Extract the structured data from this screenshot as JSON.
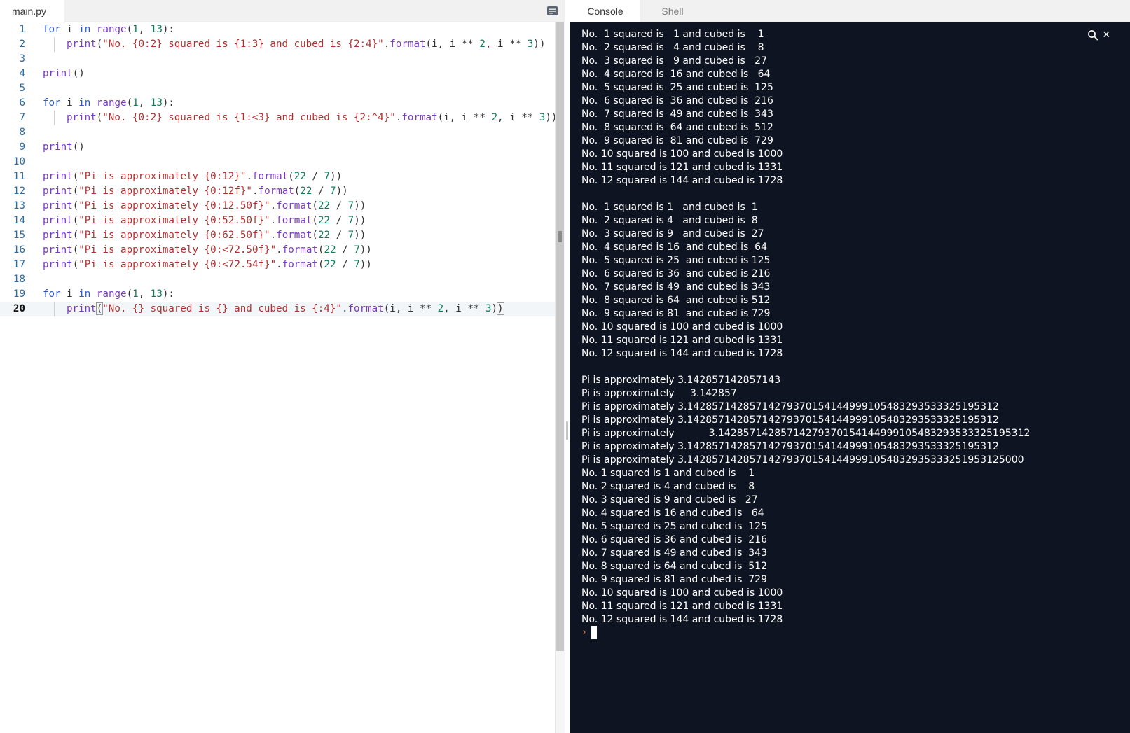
{
  "editor": {
    "tab_label": "main.py",
    "active_line": 20,
    "lines": [
      {
        "num": "1",
        "tokens": [
          [
            "k",
            "for"
          ],
          [
            "o",
            " i "
          ],
          [
            "k",
            "in"
          ],
          [
            "o",
            " "
          ],
          [
            "f",
            "range"
          ],
          [
            "o",
            "("
          ],
          [
            "n",
            "1"
          ],
          [
            "o",
            ", "
          ],
          [
            "n",
            "13"
          ],
          [
            "o",
            "):"
          ]
        ]
      },
      {
        "num": "2",
        "indent": true,
        "tokens": [
          [
            "f",
            "print"
          ],
          [
            "o",
            "("
          ],
          [
            "s",
            "\"No. {0:2} squared is {1:3} and cubed is {2:4}\""
          ],
          [
            "o",
            "."
          ],
          [
            "f",
            "format"
          ],
          [
            "o",
            "(i, i ** "
          ],
          [
            "n",
            "2"
          ],
          [
            "o",
            ", i ** "
          ],
          [
            "n",
            "3"
          ],
          [
            "o",
            "))"
          ]
        ]
      },
      {
        "num": "3",
        "tokens": []
      },
      {
        "num": "4",
        "tokens": [
          [
            "f",
            "print"
          ],
          [
            "o",
            "()"
          ]
        ]
      },
      {
        "num": "5",
        "tokens": []
      },
      {
        "num": "6",
        "tokens": [
          [
            "k",
            "for"
          ],
          [
            "o",
            " i "
          ],
          [
            "k",
            "in"
          ],
          [
            "o",
            " "
          ],
          [
            "f",
            "range"
          ],
          [
            "o",
            "("
          ],
          [
            "n",
            "1"
          ],
          [
            "o",
            ", "
          ],
          [
            "n",
            "13"
          ],
          [
            "o",
            "):"
          ]
        ]
      },
      {
        "num": "7",
        "indent": true,
        "tokens": [
          [
            "f",
            "print"
          ],
          [
            "o",
            "("
          ],
          [
            "s",
            "\"No. {0:2} squared is {1:<3} and cubed is {2:^4}\""
          ],
          [
            "o",
            "."
          ],
          [
            "f",
            "format"
          ],
          [
            "o",
            "(i, i ** "
          ],
          [
            "n",
            "2"
          ],
          [
            "o",
            ", i ** "
          ],
          [
            "n",
            "3"
          ],
          [
            "o",
            "))"
          ]
        ]
      },
      {
        "num": "8",
        "tokens": []
      },
      {
        "num": "9",
        "tokens": [
          [
            "f",
            "print"
          ],
          [
            "o",
            "()"
          ]
        ]
      },
      {
        "num": "10",
        "tokens": []
      },
      {
        "num": "11",
        "tokens": [
          [
            "f",
            "print"
          ],
          [
            "o",
            "("
          ],
          [
            "s",
            "\"Pi is approximately {0:12}\""
          ],
          [
            "o",
            "."
          ],
          [
            "f",
            "format"
          ],
          [
            "o",
            "("
          ],
          [
            "n",
            "22"
          ],
          [
            "o",
            " / "
          ],
          [
            "n",
            "7"
          ],
          [
            "o",
            "))"
          ]
        ]
      },
      {
        "num": "12",
        "tokens": [
          [
            "f",
            "print"
          ],
          [
            "o",
            "("
          ],
          [
            "s",
            "\"Pi is approximately {0:12f}\""
          ],
          [
            "o",
            "."
          ],
          [
            "f",
            "format"
          ],
          [
            "o",
            "("
          ],
          [
            "n",
            "22"
          ],
          [
            "o",
            " / "
          ],
          [
            "n",
            "7"
          ],
          [
            "o",
            "))"
          ]
        ]
      },
      {
        "num": "13",
        "tokens": [
          [
            "f",
            "print"
          ],
          [
            "o",
            "("
          ],
          [
            "s",
            "\"Pi is approximately {0:12.50f}\""
          ],
          [
            "o",
            "."
          ],
          [
            "f",
            "format"
          ],
          [
            "o",
            "("
          ],
          [
            "n",
            "22"
          ],
          [
            "o",
            " / "
          ],
          [
            "n",
            "7"
          ],
          [
            "o",
            "))"
          ]
        ]
      },
      {
        "num": "14",
        "tokens": [
          [
            "f",
            "print"
          ],
          [
            "o",
            "("
          ],
          [
            "s",
            "\"Pi is approximately {0:52.50f}\""
          ],
          [
            "o",
            "."
          ],
          [
            "f",
            "format"
          ],
          [
            "o",
            "("
          ],
          [
            "n",
            "22"
          ],
          [
            "o",
            " / "
          ],
          [
            "n",
            "7"
          ],
          [
            "o",
            "))"
          ]
        ]
      },
      {
        "num": "15",
        "tokens": [
          [
            "f",
            "print"
          ],
          [
            "o",
            "("
          ],
          [
            "s",
            "\"Pi is approximately {0:62.50f}\""
          ],
          [
            "o",
            "."
          ],
          [
            "f",
            "format"
          ],
          [
            "o",
            "("
          ],
          [
            "n",
            "22"
          ],
          [
            "o",
            " / "
          ],
          [
            "n",
            "7"
          ],
          [
            "o",
            "))"
          ]
        ]
      },
      {
        "num": "16",
        "tokens": [
          [
            "f",
            "print"
          ],
          [
            "o",
            "("
          ],
          [
            "s",
            "\"Pi is approximately {0:<72.50f}\""
          ],
          [
            "o",
            "."
          ],
          [
            "f",
            "format"
          ],
          [
            "o",
            "("
          ],
          [
            "n",
            "22"
          ],
          [
            "o",
            " / "
          ],
          [
            "n",
            "7"
          ],
          [
            "o",
            "))"
          ]
        ]
      },
      {
        "num": "17",
        "tokens": [
          [
            "f",
            "print"
          ],
          [
            "o",
            "("
          ],
          [
            "s",
            "\"Pi is approximately {0:<72.54f}\""
          ],
          [
            "o",
            "."
          ],
          [
            "f",
            "format"
          ],
          [
            "o",
            "("
          ],
          [
            "n",
            "22"
          ],
          [
            "o",
            " / "
          ],
          [
            "n",
            "7"
          ],
          [
            "o",
            "))"
          ]
        ]
      },
      {
        "num": "18",
        "tokens": []
      },
      {
        "num": "19",
        "tokens": [
          [
            "k",
            "for"
          ],
          [
            "o",
            " i "
          ],
          [
            "k",
            "in"
          ],
          [
            "o",
            " "
          ],
          [
            "f",
            "range"
          ],
          [
            "o",
            "("
          ],
          [
            "n",
            "1"
          ],
          [
            "o",
            ", "
          ],
          [
            "n",
            "13"
          ],
          [
            "o",
            "):"
          ]
        ]
      },
      {
        "num": "20",
        "indent": true,
        "tokens": [
          [
            "f",
            "print"
          ],
          [
            "b",
            "("
          ],
          [
            "s",
            "\"No. {} squared is {} and cubed is {:4}\""
          ],
          [
            "o",
            "."
          ],
          [
            "f",
            "format"
          ],
          [
            "o",
            "(i, i ** "
          ],
          [
            "n",
            "2"
          ],
          [
            "o",
            ", i ** "
          ],
          [
            "n",
            "3"
          ],
          [
            "o",
            ")"
          ],
          [
            "b",
            ")"
          ]
        ]
      }
    ]
  },
  "console": {
    "tabs": [
      {
        "label": "Console",
        "active": true
      },
      {
        "label": "Shell",
        "active": false
      }
    ],
    "search_icon": "search-icon",
    "close_glyph": "×",
    "prompt": "›",
    "output": [
      "No.  1 squared is   1 and cubed is    1",
      "No.  2 squared is   4 and cubed is    8",
      "No.  3 squared is   9 and cubed is   27",
      "No.  4 squared is  16 and cubed is   64",
      "No.  5 squared is  25 and cubed is  125",
      "No.  6 squared is  36 and cubed is  216",
      "No.  7 squared is  49 and cubed is  343",
      "No.  8 squared is  64 and cubed is  512",
      "No.  9 squared is  81 and cubed is  729",
      "No. 10 squared is 100 and cubed is 1000",
      "No. 11 squared is 121 and cubed is 1331",
      "No. 12 squared is 144 and cubed is 1728",
      "",
      "No.  1 squared is 1   and cubed is  1",
      "No.  2 squared is 4   and cubed is  8",
      "No.  3 squared is 9   and cubed is  27",
      "No.  4 squared is 16  and cubed is  64",
      "No.  5 squared is 25  and cubed is 125",
      "No.  6 squared is 36  and cubed is 216",
      "No.  7 squared is 49  and cubed is 343",
      "No.  8 squared is 64  and cubed is 512",
      "No.  9 squared is 81  and cubed is 729",
      "No. 10 squared is 100 and cubed is 1000",
      "No. 11 squared is 121 and cubed is 1331",
      "No. 12 squared is 144 and cubed is 1728",
      "",
      "Pi is approximately 3.142857142857143",
      "Pi is approximately     3.142857",
      "Pi is approximately 3.14285714285714279370154144999105483293533325195312",
      "Pi is approximately 3.14285714285714279370154144999105483293533325195312",
      "Pi is approximately           3.14285714285714279370154144999105483293533325195312",
      "Pi is approximately 3.14285714285714279370154144999105483293533325195312",
      "Pi is approximately 3.142857142857142793701541449991054832935333251953125000",
      "No. 1 squared is 1 and cubed is    1",
      "No. 2 squared is 4 and cubed is    8",
      "No. 3 squared is 9 and cubed is   27",
      "No. 4 squared is 16 and cubed is   64",
      "No. 5 squared is 25 and cubed is  125",
      "No. 6 squared is 36 and cubed is  216",
      "No. 7 squared is 49 and cubed is  343",
      "No. 8 squared is 64 and cubed is  512",
      "No. 9 squared is 81 and cubed is  729",
      "No. 10 squared is 100 and cubed is 1000",
      "No. 11 squared is 121 and cubed is 1331",
      "No. 12 squared is 144 and cubed is 1728"
    ]
  }
}
